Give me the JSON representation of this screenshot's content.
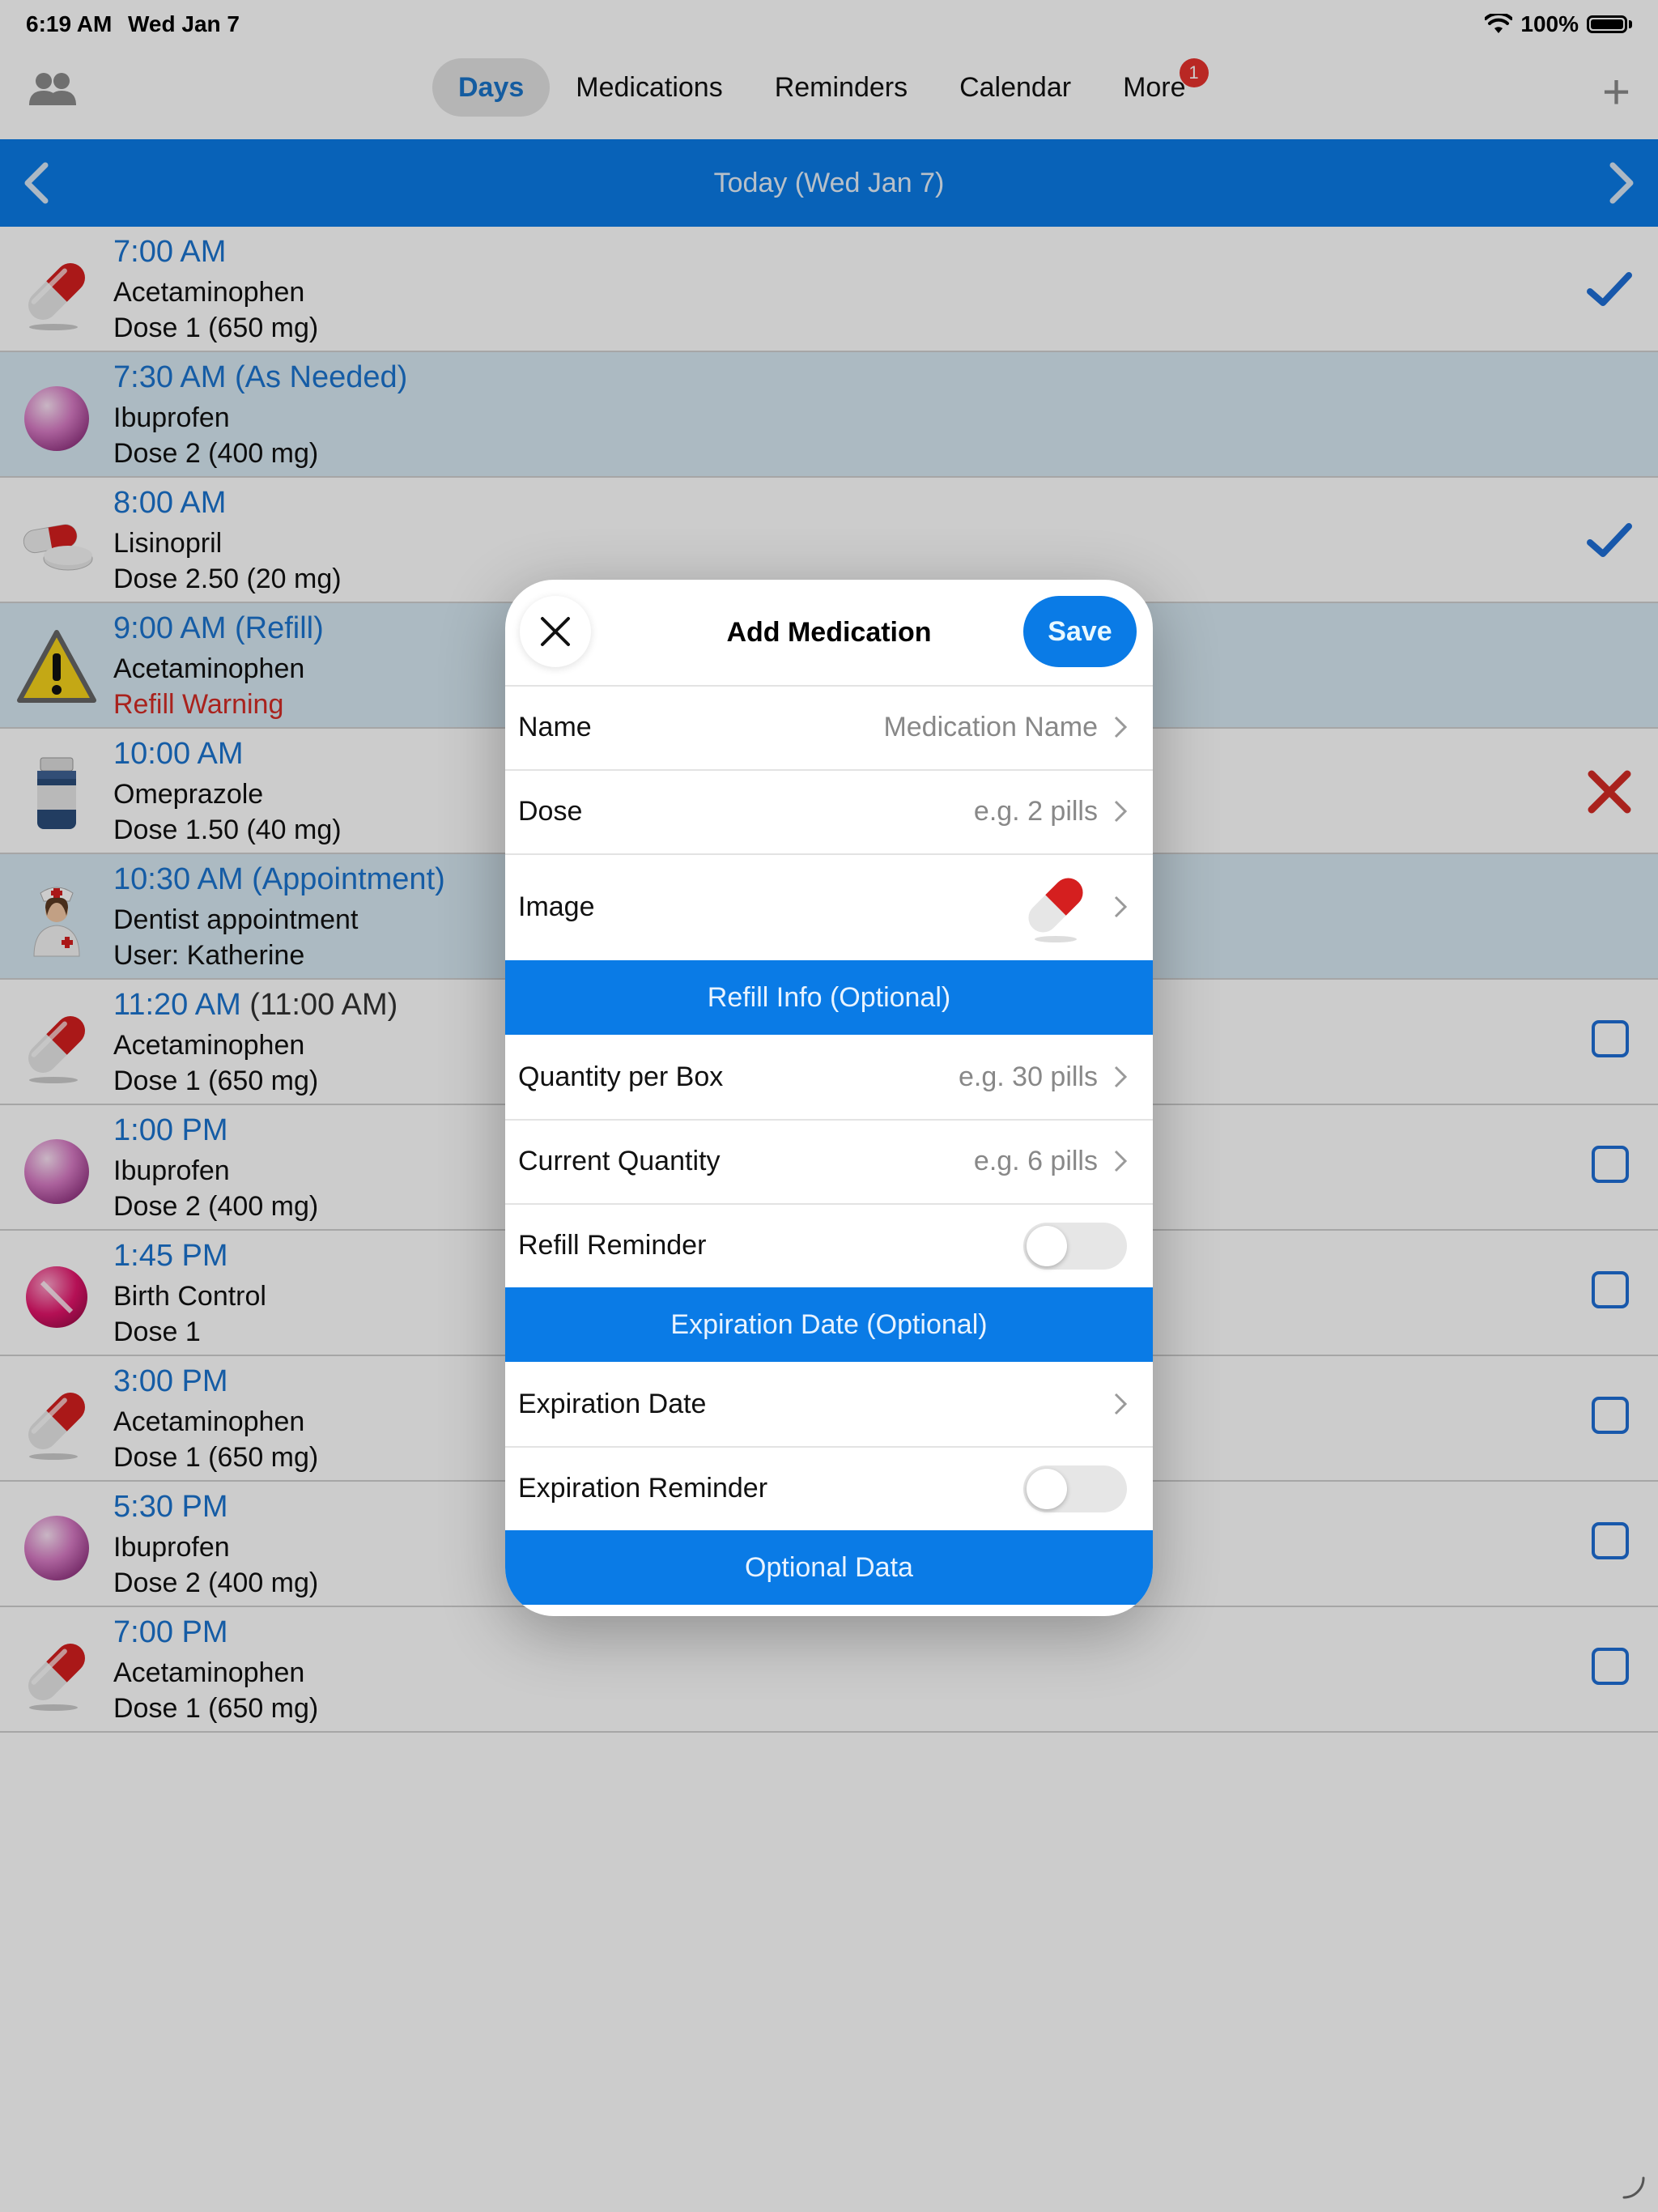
{
  "status_bar": {
    "time": "6:19 AM",
    "date": "Wed Jan 7",
    "battery": "100%"
  },
  "nav": {
    "tabs": [
      {
        "label": "Days",
        "active": true
      },
      {
        "label": "Medications",
        "active": false
      },
      {
        "label": "Reminders",
        "active": false
      },
      {
        "label": "Calendar",
        "active": false
      },
      {
        "label": "More",
        "active": false,
        "badge": "1"
      }
    ],
    "users_icon": "users-icon",
    "add_icon": "plus-icon"
  },
  "day_header": {
    "title": "Today (Wed Jan 7)"
  },
  "schedule": [
    {
      "time": "7:00 AM",
      "orig": "",
      "name": "Acetaminophen",
      "detail": "Dose 1 (650 mg)",
      "icon": "capsule-red",
      "status": "taken",
      "alt": false
    },
    {
      "time": "7:30 AM (As Needed)",
      "orig": "",
      "name": "Ibuprofen",
      "detail": "Dose 2 (400 mg)",
      "icon": "pill-pink-round",
      "status": "none",
      "alt": true
    },
    {
      "time": "8:00 AM",
      "orig": "",
      "name": "Lisinopril",
      "detail": "Dose 2.50 (20 mg)",
      "icon": "pills-mixed",
      "status": "taken",
      "alt": false
    },
    {
      "time": "9:00 AM (Refill)",
      "orig": "",
      "name": "Acetaminophen",
      "detail": "Refill Warning",
      "icon": "warning-triangle",
      "status": "none",
      "alt": true,
      "warn": true
    },
    {
      "time": "10:00 AM",
      "orig": "",
      "name": "Omeprazole",
      "detail": "Dose 1.50 (40 mg)",
      "icon": "pill-bottle",
      "status": "skipped",
      "alt": false
    },
    {
      "time": "10:30 AM (Appointment)",
      "orig": "",
      "name": "Dentist appointment",
      "detail": "User: Katherine",
      "icon": "nurse",
      "status": "none",
      "alt": true
    },
    {
      "time": "11:20 AM",
      "orig": " (11:00 AM)",
      "name": "Acetaminophen",
      "detail": "Dose 1 (650 mg)",
      "icon": "capsule-red",
      "status": "pending",
      "alt": false
    },
    {
      "time": "1:00 PM",
      "orig": "",
      "name": "Ibuprofen",
      "detail": "Dose 2 (400 mg)",
      "icon": "pill-pink-round",
      "status": "pending",
      "alt": false
    },
    {
      "time": "1:45 PM",
      "orig": "",
      "name": "Birth Control",
      "detail": "Dose 1",
      "icon": "pill-magenta-scored",
      "status": "pending",
      "alt": false
    },
    {
      "time": "3:00 PM",
      "orig": "",
      "name": "Acetaminophen",
      "detail": "Dose 1 (650 mg)",
      "icon": "capsule-red",
      "status": "pending",
      "alt": false
    },
    {
      "time": "5:30 PM",
      "orig": "",
      "name": "Ibuprofen",
      "detail": "Dose 2 (400 mg)",
      "icon": "pill-pink-round",
      "status": "pending",
      "alt": false
    },
    {
      "time": "7:00 PM",
      "orig": "",
      "name": "Acetaminophen",
      "detail": "Dose 1 (650 mg)",
      "icon": "capsule-red",
      "status": "pending",
      "alt": false
    }
  ],
  "modal": {
    "title": "Add Medication",
    "save_label": "Save",
    "name": {
      "label": "Name",
      "placeholder": "Medication Name"
    },
    "dose": {
      "label": "Dose",
      "placeholder": "e.g. 2 pills"
    },
    "image": {
      "label": "Image",
      "icon": "capsule-red"
    },
    "refill_section": "Refill Info (Optional)",
    "quantity_per_box": {
      "label": "Quantity per Box",
      "placeholder": "e.g. 30 pills"
    },
    "current_quantity": {
      "label": "Current Quantity",
      "placeholder": "e.g. 6 pills"
    },
    "refill_reminder": {
      "label": "Refill Reminder",
      "on": false
    },
    "expiration_section": "Expiration Date (Optional)",
    "expiration_date": {
      "label": "Expiration Date"
    },
    "expiration_reminder": {
      "label": "Expiration Reminder",
      "on": false
    },
    "optional_section": "Optional Data"
  },
  "colors": {
    "accent": "#0a7be6",
    "time_text": "#1b74cf",
    "warning": "#d42b25",
    "checkbox": "#1f6fd6"
  }
}
